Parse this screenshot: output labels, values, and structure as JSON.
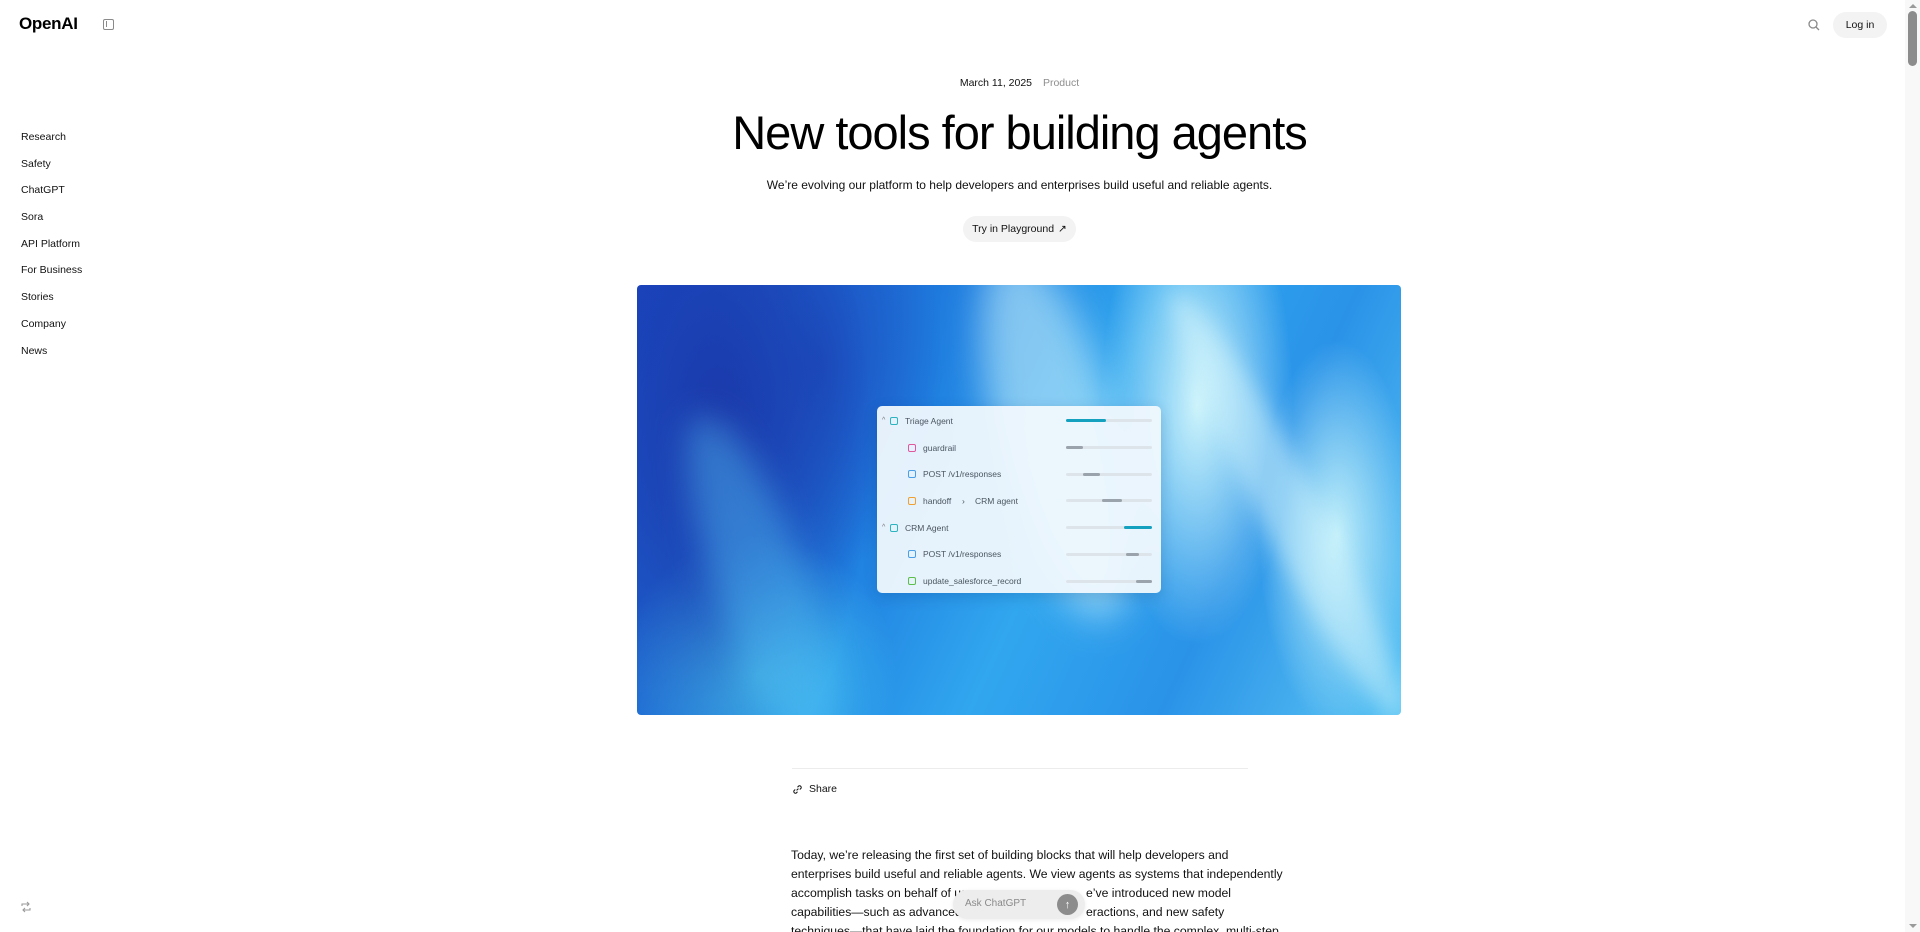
{
  "header": {
    "logo": "OpenAI",
    "sidebar_toggle_icon": "sidebar-toggle-icon",
    "search_icon": "search-icon",
    "login_label": "Log in"
  },
  "sidebar": {
    "items": [
      {
        "label": "Research"
      },
      {
        "label": "Safety"
      },
      {
        "label": "ChatGPT"
      },
      {
        "label": "Sora"
      },
      {
        "label": "API Platform"
      },
      {
        "label": "For Business"
      },
      {
        "label": "Stories"
      },
      {
        "label": "Company"
      },
      {
        "label": "News"
      }
    ],
    "bottom_icon": "refresh-icon"
  },
  "article": {
    "date": "March 11, 2025",
    "category": "Product",
    "title": "New tools for building agents",
    "subtitle": "We’re evolving our platform to help developers and enterprises build useful and reliable agents.",
    "cta_label": "Try in Playground",
    "cta_icon": "↗",
    "share_label": "Share",
    "body_lines": [
      {
        "a": "Today, we’re releasing the first set of building blocks that will help developers and",
        "b": ""
      },
      {
        "a": "enterprises build useful and reliable agents. We view agents as systems that independently",
        "b": ""
      },
      {
        "a": "accomplish tasks on behalf of us",
        "b": "e’ve introduced new model"
      },
      {
        "a": "capabilities—such as advanced r",
        "b": "eractions, and new safety"
      },
      {
        "a": "techniques—that have laid the foundation for our models to handle the complex, multi-step",
        "b": ""
      }
    ]
  },
  "hero_panel": {
    "rows": [
      {
        "label": "Triage Agent",
        "label2": "",
        "icon": "agent-icon",
        "icon_color": "#2bb3c0",
        "level": 0,
        "collapsible": true,
        "bar_start": 0.0,
        "bar_end": 0.47,
        "bar_color": "#14a1c0"
      },
      {
        "label": "guardrail",
        "label2": "",
        "icon": "guardrail-icon",
        "icon_color": "#e0579b",
        "level": 1,
        "collapsible": false,
        "bar_start": 0.0,
        "bar_end": 0.2,
        "bar_color": "#9aa3ab"
      },
      {
        "label": "POST /v1/responses",
        "label2": "",
        "icon": "response-icon",
        "icon_color": "#4a9fe6",
        "level": 1,
        "collapsible": false,
        "bar_start": 0.2,
        "bar_end": 0.4,
        "bar_color": "#9aa3ab"
      },
      {
        "label": "handoff",
        "label2": "CRM agent",
        "icon": "handoff-icon",
        "icon_color": "#f0a030",
        "level": 1,
        "collapsible": false,
        "bar_start": 0.42,
        "bar_end": 0.65,
        "bar_color": "#9aa3ab"
      },
      {
        "label": "CRM Agent",
        "label2": "",
        "icon": "agent-icon",
        "icon_color": "#2bb3c0",
        "level": 0,
        "collapsible": true,
        "bar_start": 0.68,
        "bar_end": 1.0,
        "bar_color": "#14a1c0"
      },
      {
        "label": "POST /v1/responses",
        "label2": "",
        "icon": "response-icon",
        "icon_color": "#4a9fe6",
        "level": 1,
        "collapsible": false,
        "bar_start": 0.7,
        "bar_end": 0.85,
        "bar_color": "#9aa3ab"
      },
      {
        "label": "update_salesforce_record",
        "label2": "",
        "icon": "function-icon",
        "icon_color": "#5cbf4a",
        "level": 1,
        "collapsible": false,
        "bar_start": 0.81,
        "bar_end": 1.0,
        "bar_color": "#9aa3ab"
      }
    ]
  },
  "ask_chatgpt": {
    "placeholder": "Ask ChatGPT",
    "send_icon": "↑"
  }
}
